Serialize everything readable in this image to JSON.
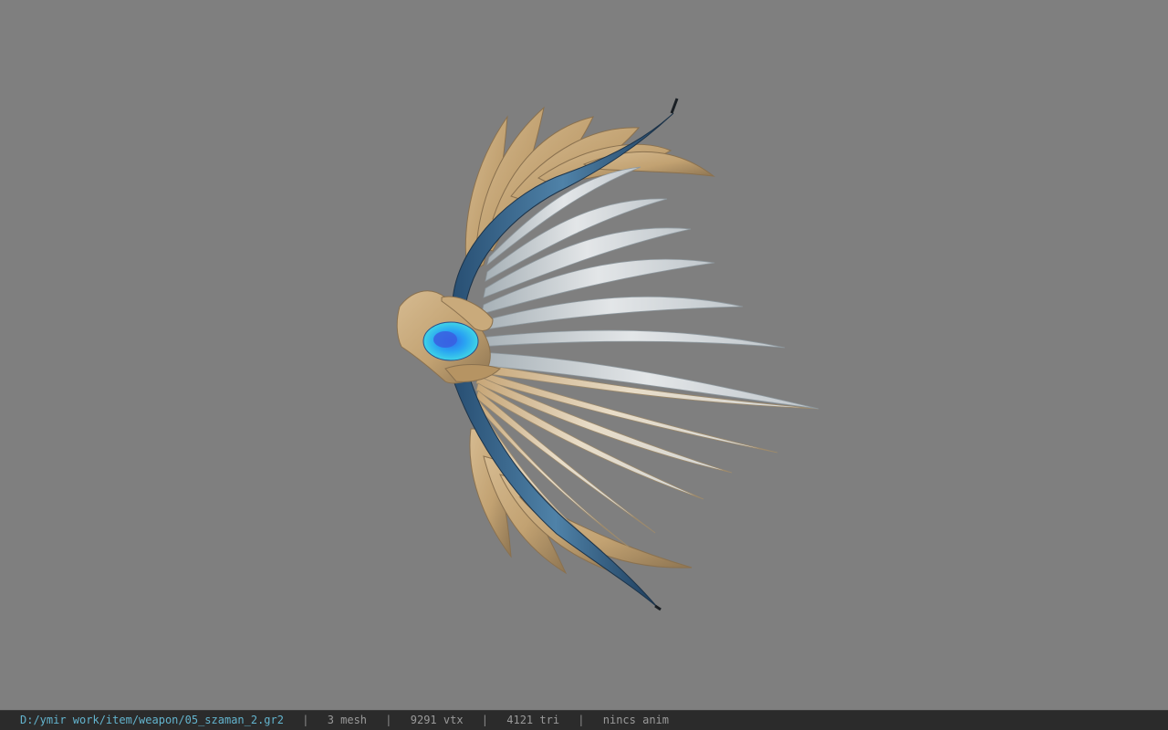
{
  "viewport": {
    "background": "#7f7f7f",
    "model_description_icon": "winged-bow-model"
  },
  "statusbar": {
    "path": "D:/ymir work/item/weapon/05_szaman_2.gr2",
    "separator": "|",
    "mesh": "3 mesh",
    "vtx": "9291 vtx",
    "tri": "4121 tri",
    "anim": "nincs anim",
    "path_color": "#63b4ce"
  }
}
